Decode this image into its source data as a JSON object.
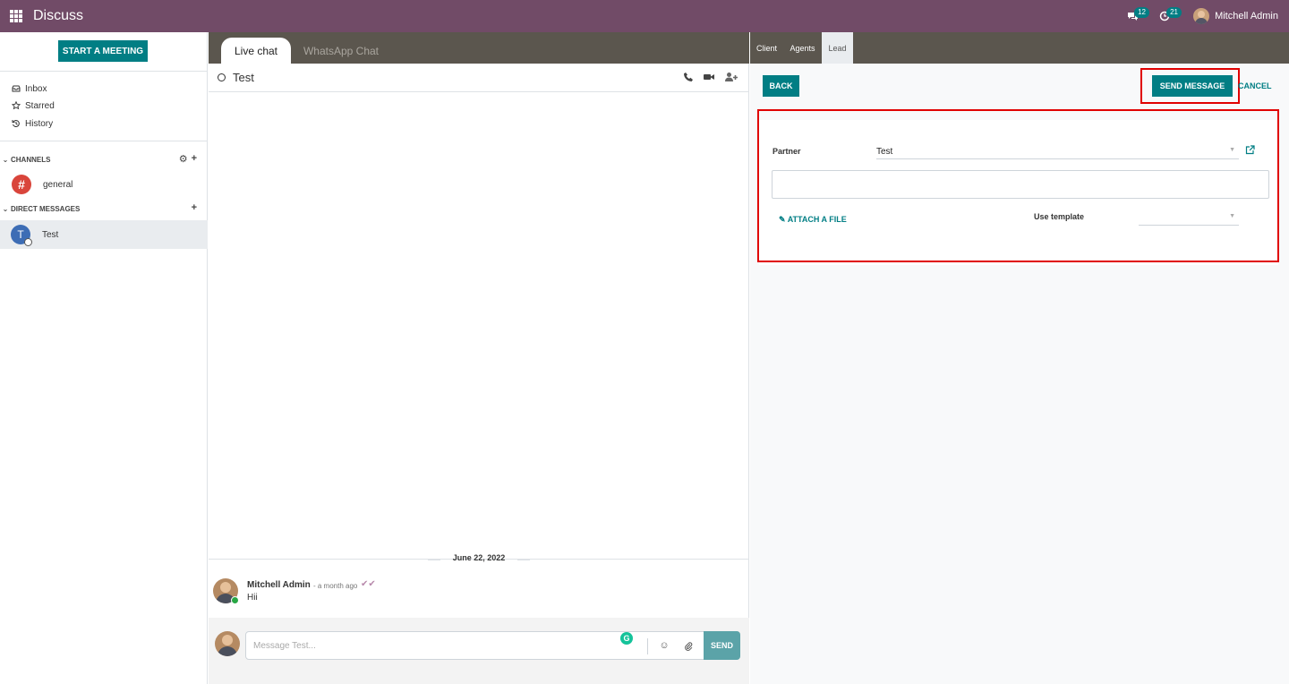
{
  "navbar": {
    "app_title": "Discuss",
    "messages_count": "12",
    "activities_count": "21",
    "user_name": "Mitchell Admin"
  },
  "sidebar": {
    "start_meeting": "START A MEETING",
    "mailboxes": [
      {
        "label": "Inbox",
        "icon": "inbox-icon"
      },
      {
        "label": "Starred",
        "icon": "star-icon"
      },
      {
        "label": "History",
        "icon": "history-icon"
      }
    ],
    "channels_header": "CHANNELS",
    "channels": [
      {
        "name": "general"
      }
    ],
    "direct_messages_header": "DIRECT MESSAGES",
    "direct_messages": [
      {
        "name": "Test",
        "initial": "T"
      }
    ]
  },
  "thread": {
    "tabs": [
      {
        "label": "Live chat",
        "active": true
      },
      {
        "label": "WhatsApp Chat",
        "active": false
      }
    ],
    "name": "Test",
    "date_separator": "June 22, 2022",
    "messages": [
      {
        "author": "Mitchell Admin",
        "time": "- a month ago",
        "body": "Hii"
      }
    ],
    "composer": {
      "placeholder": "Message Test...",
      "send_label": "SEND"
    }
  },
  "rpanel": {
    "tabs": [
      {
        "label": "Client",
        "active": false
      },
      {
        "label": "Agents",
        "active": false
      },
      {
        "label": "Lead",
        "active": true
      }
    ],
    "back_label": "BACK",
    "send_message_label": "SEND MESSAGE",
    "cancel_label": "CANCEL",
    "form": {
      "partner_label": "Partner",
      "partner_value": "Test",
      "attach_label": "ATTACH A FILE",
      "template_label": "Use template",
      "template_value": ""
    }
  },
  "colors": {
    "navbar": "#714b67",
    "primary": "#017e84",
    "highlight": "#e00000",
    "tabbar": "#5b564e"
  }
}
